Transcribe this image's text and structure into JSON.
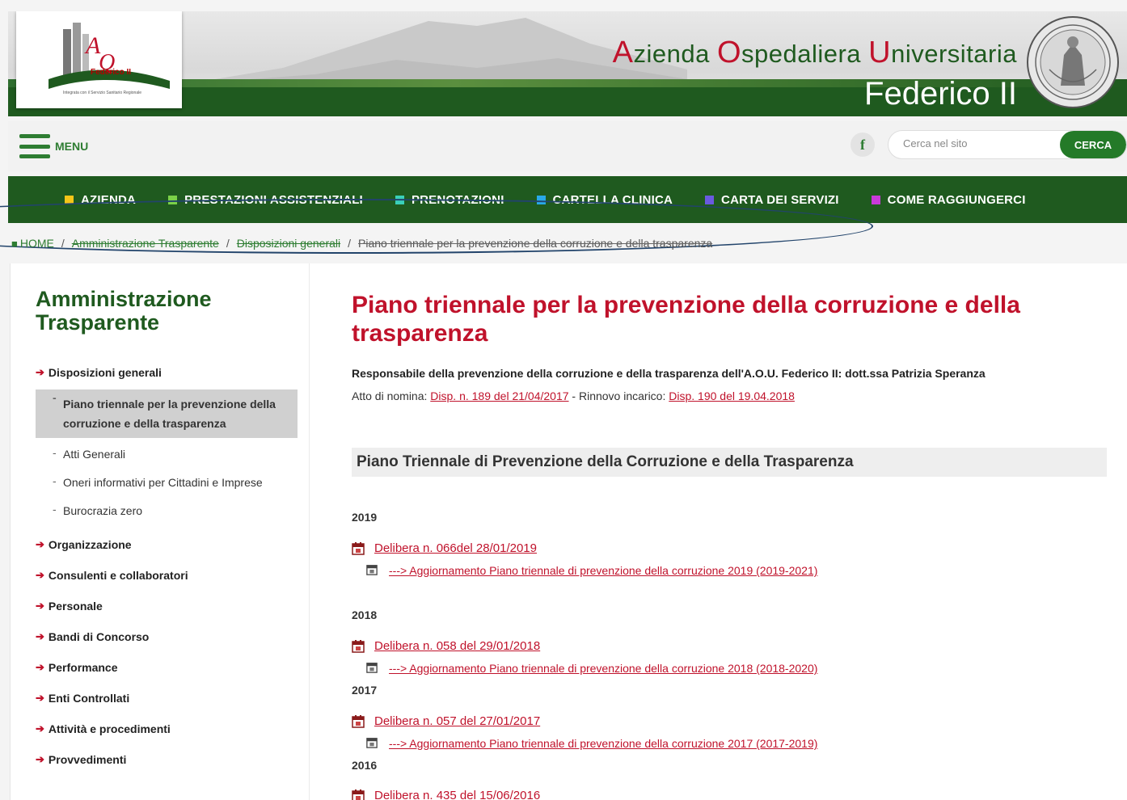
{
  "header": {
    "logo_text": "Federico II",
    "logo_sub": "Integrata con il Servizio Sanitario Regionale",
    "brand_line1_parts": [
      {
        "cap": "A",
        "rest": "zienda "
      },
      {
        "cap": "O",
        "rest": "spedaliera "
      },
      {
        "cap": "U",
        "rest": "niversitaria"
      }
    ],
    "brand_line2": "Federico II"
  },
  "utility": {
    "menu_label": "MENU",
    "facebook_glyph": "f",
    "search_placeholder": "Cerca nel sito",
    "search_button": "CERCA"
  },
  "nav": {
    "items": [
      {
        "label": "AZIENDA",
        "color": "#f5c518"
      },
      {
        "label": "PRESTAZIONI ASSISTENZIALI",
        "color": "#7bd148"
      },
      {
        "label": "PRENOTAZIONI",
        "color": "#3ad0b9"
      },
      {
        "label": "CARTELLA CLINICA",
        "color": "#29a9e8"
      },
      {
        "label": "CARTA DEI SERVIZI",
        "color": "#6a5ae0"
      },
      {
        "label": "COME RAGGIUNGERCI",
        "color": "#c83ad9"
      }
    ]
  },
  "breadcrumb": {
    "home": "HOME",
    "items": [
      "Amministrazione Trasparente",
      "Disposizioni generali"
    ],
    "current": "Piano triennale per la prevenzione della corruzione e della trasparenza",
    "sep": "/"
  },
  "sidebar": {
    "title": "Amministrazione Trasparente",
    "section": "Disposizioni generali",
    "subitems": [
      {
        "label": "Piano triennale per la prevenzione della corruzione e della trasparenza",
        "active": true
      },
      {
        "label": "Atti Generali",
        "active": false
      },
      {
        "label": "Oneri informativi per Cittadini e Imprese",
        "active": false
      },
      {
        "label": "Burocrazia zero",
        "active": false
      }
    ],
    "items": [
      "Organizzazione",
      "Consulenti e collaboratori",
      "Personale",
      "Bandi di Concorso",
      "Performance",
      "Enti Controllati",
      "Attività e procedimenti",
      "Provvedimenti"
    ]
  },
  "main": {
    "title": "Piano triennale per la prevenzione della corruzione e della trasparenza",
    "responsible": "Responsabile della prevenzione della corruzione e della trasparenza dell'A.O.U. Federico II: dott.ssa Patrizia Speranza",
    "atto_label": "Atto di nomina: ",
    "atto_link": "Disp. n. 189 del 21/04/2017",
    "rinnovo_label": " - Rinnovo incarico: ",
    "rinnovo_link": "Disp. 190 del 19.04.2018",
    "section_title": "Piano Triennale di Prevenzione della Corruzione e della Trasparenza",
    "years": [
      {
        "year": "2019",
        "delibera": "Delibera n. 066del 28/01/2019",
        "aggiornamento": "---> Aggiornamento Piano triennale di prevenzione della corruzione 2019 (2019-2021)"
      },
      {
        "year": "2018",
        "delibera": "Delibera n. 058 del 29/01/2018",
        "aggiornamento": "---> Aggiornamento Piano triennale di prevenzione della corruzione 2018 (2018-2020)"
      },
      {
        "year": "2017",
        "delibera": "Delibera n. 057 del 27/01/2017",
        "aggiornamento": "---> Aggiornamento Piano triennale di prevenzione della corruzione 2017 (2017-2019)"
      },
      {
        "year": "2016",
        "delibera": "Delibera n. 435 del 15/06/2016",
        "aggiornamento": ""
      }
    ]
  }
}
